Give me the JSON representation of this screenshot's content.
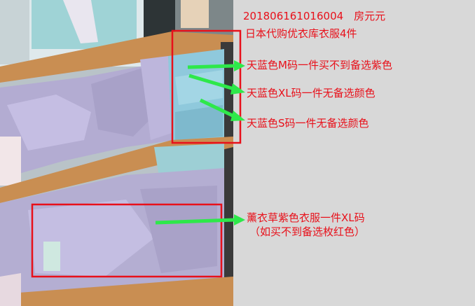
{
  "header": {
    "order_line": "201806161016004　房元元",
    "title": "日本代购优衣库衣服4件"
  },
  "items": [
    {
      "label": "天蓝色M码一件买不到备选紫色"
    },
    {
      "label": "天蓝色XL码一件无备选颜色"
    },
    {
      "label": "天蓝色S码一件无备选颜色"
    },
    {
      "label": "薰衣草紫色衣服一件XL码",
      "note": "（如买不到备选枚红色）"
    }
  ],
  "colors": {
    "annotation_text": "#e8101a",
    "box_stroke": "#e8101a",
    "arrow": "#2ee84a",
    "panel_bg": "#d8d8d8"
  }
}
